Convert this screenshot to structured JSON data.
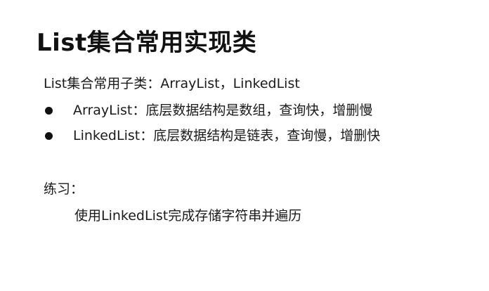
{
  "slide": {
    "title": "List集合常用实现类",
    "intro": "List集合常用子类：ArrayList，LinkedList",
    "bullets": [
      "ArrayList：底层数据结构是数组，查询快，增删慢",
      "LinkedList：底层数据结构是链表，查询慢，增删快"
    ],
    "practice_label": "练习：",
    "practice_task": "使用LinkedList完成存储字符串并遍历"
  }
}
